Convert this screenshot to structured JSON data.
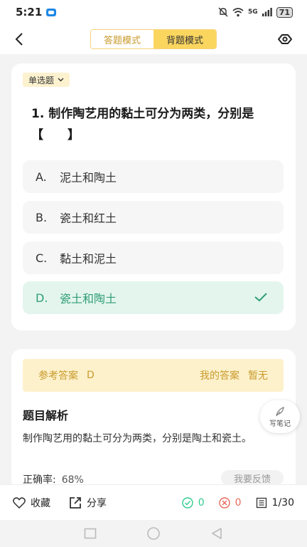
{
  "status_bar": {
    "time": "5:21",
    "battery": "71",
    "network": "5G"
  },
  "header": {
    "modes": [
      {
        "label": "答题模式",
        "active": false
      },
      {
        "label": "背题模式",
        "active": true
      }
    ],
    "icons": {
      "back": "back-arrow-icon",
      "eye": "eye-icon"
    }
  },
  "question": {
    "type_label": "单选题",
    "text": "1. 制作陶艺用的黏土可分为两类，分别是【　　】",
    "options": [
      {
        "letter": "A.",
        "text": "泥土和陶土",
        "correct": false
      },
      {
        "letter": "B.",
        "text": "瓷土和红土",
        "correct": false
      },
      {
        "letter": "C.",
        "text": "黏土和泥土",
        "correct": false
      },
      {
        "letter": "D.",
        "text": "瓷土和陶土",
        "correct": true
      }
    ]
  },
  "analysis": {
    "reference_label": "参考答案",
    "reference_value": "D",
    "my_answer_label": "我的答案",
    "my_answer_value": "暂无",
    "title": "题目解析",
    "text": "制作陶艺用的黏土可分为两类，分别是陶土和瓷土。",
    "accuracy_label": "正确率:",
    "accuracy_value": "68%",
    "feedback_label": "我要反馈"
  },
  "notes_button": {
    "label": "写笔记"
  },
  "bottom_bar": {
    "favorite_label": "收藏",
    "share_label": "分享",
    "correct_count": "0",
    "wrong_count": "0",
    "progress": "1/30"
  },
  "colors": {
    "accent_yellow": "#fbd65f",
    "correct_green": "#2f9e73",
    "wrong_red": "#e86a5b"
  }
}
